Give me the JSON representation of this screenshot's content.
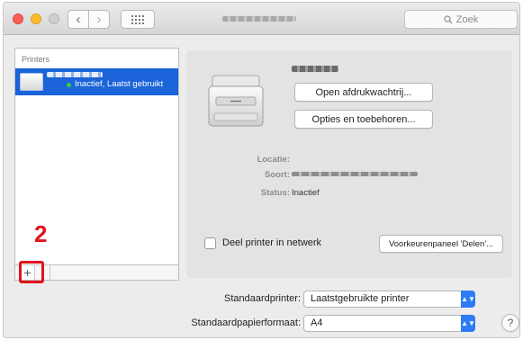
{
  "window": {
    "title": "",
    "search_placeholder": "Zoek",
    "search_icon": "magnifier-icon"
  },
  "printers": {
    "header": "Printers",
    "items": [
      {
        "status": "Inactief, Laatst gebruikt",
        "selected": true
      }
    ]
  },
  "annotation": {
    "step_number": "2",
    "color": "#e0141c"
  },
  "list_controls": {
    "add_label": "+",
    "remove_label": "-"
  },
  "details": {
    "open_queue_label": "Open afdrukwachtrij...",
    "options_label": "Opties en toebehoren...",
    "location_label": "Locatie:",
    "kind_label": "Soort:",
    "status_label": "Status:",
    "status_value": "Inactief",
    "share_label": "Deel printer in netwerk",
    "share_prefs_label": "Voorkeurenpaneel 'Delen'..."
  },
  "defaults": {
    "printer_label": "Standaardprinter:",
    "printer_value": "Laatstgebruikte printer",
    "paper_label": "Standaardpapierformaat:",
    "paper_value": "A4"
  },
  "help_label": "?",
  "colors": {
    "selection": "#1a63d8",
    "accent": "#2f7bf5"
  }
}
